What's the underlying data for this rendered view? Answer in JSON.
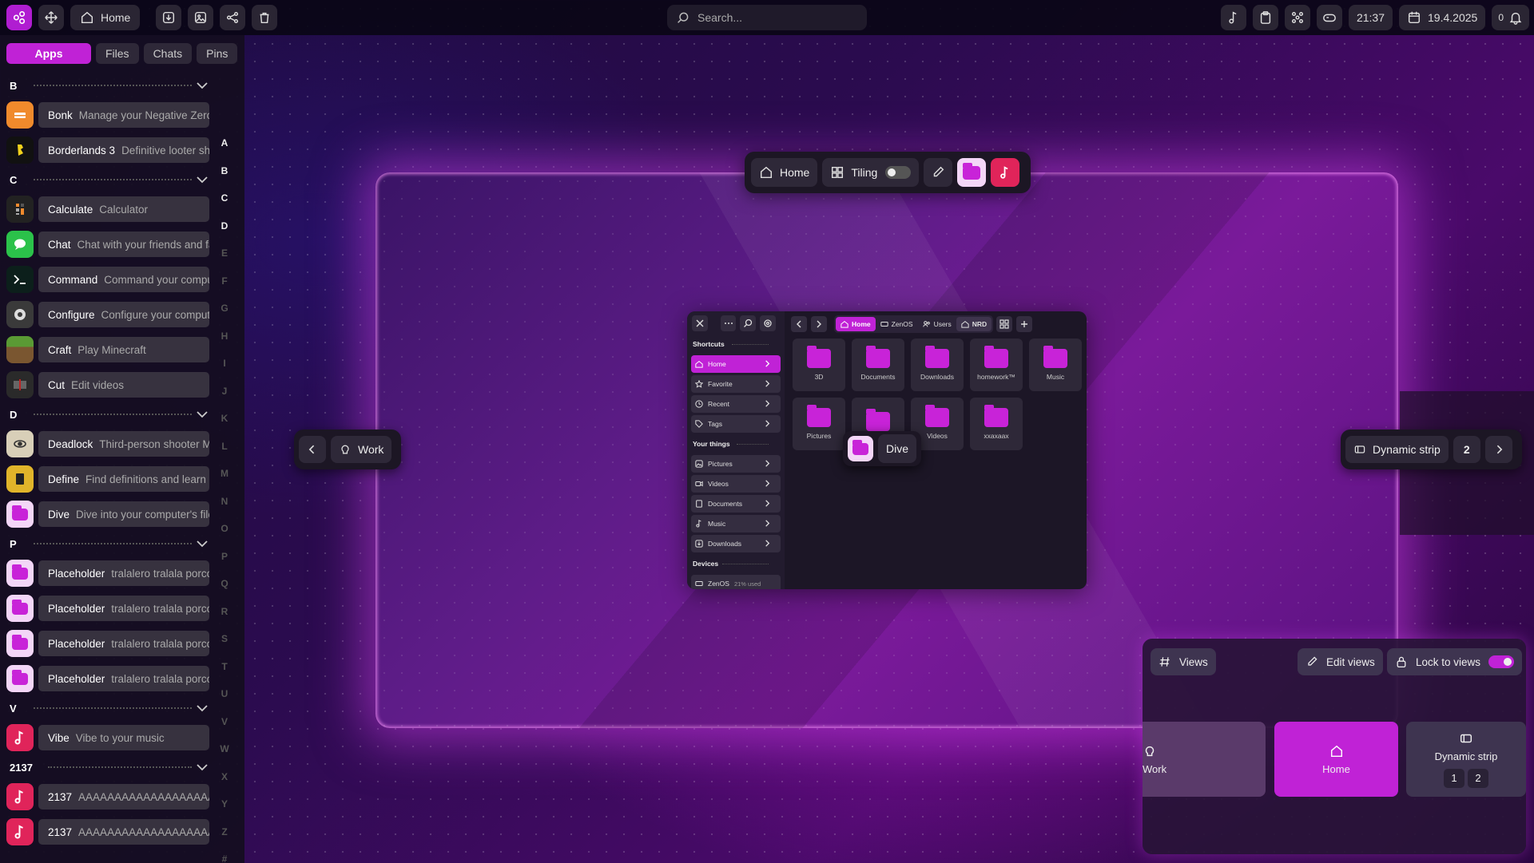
{
  "topbar": {
    "home_label": "Home",
    "search_placeholder": "Search...",
    "time": "21:37",
    "date": "19.4.2025",
    "notif_count": "0",
    "accent": "#b01dd1"
  },
  "left": {
    "tabs": [
      "Apps",
      "Files",
      "Chats",
      "Pins"
    ],
    "sections": {
      "B": "B",
      "C": "C",
      "D": "D",
      "P": "P",
      "V": "V",
      "N": "2137"
    },
    "apps": {
      "bonk": {
        "name": "Bonk",
        "desc": "Manage your Negative Zero"
      },
      "borderlands": {
        "name": "Borderlands 3",
        "desc": "Definitive looter shooter"
      },
      "calculate": {
        "name": "Calculate",
        "desc": "Calculator"
      },
      "chat": {
        "name": "Chat",
        "desc": "Chat with your friends and family"
      },
      "command": {
        "name": "Command",
        "desc": "Command your computer"
      },
      "configure": {
        "name": "Configure",
        "desc": "Configure your computer"
      },
      "craft": {
        "name": "Craft",
        "desc": "Play Minecraft"
      },
      "cut": {
        "name": "Cut",
        "desc": "Edit videos"
      },
      "deadlock": {
        "name": "Deadlock",
        "desc": "Third-person shooter MOBA"
      },
      "define": {
        "name": "Define",
        "desc": "Find definitions and learn"
      },
      "dive": {
        "name": "Dive",
        "desc": "Dive into your computer's files"
      },
      "ph1": {
        "name": "Placeholder",
        "desc": "tralalero tralala porco dio"
      },
      "ph2": {
        "name": "Placeholder",
        "desc": "tralalero tralala porco dio"
      },
      "ph3": {
        "name": "Placeholder",
        "desc": "tralalero tralala porco dio"
      },
      "ph4": {
        "name": "Placeholder",
        "desc": "tralalero tralala porco dio"
      },
      "vibe": {
        "name": "Vibe",
        "desc": "Vibe to your music"
      },
      "n1": {
        "name": "2137",
        "desc": "AAAAAAAAAAAAAAAAAAAA"
      },
      "n2": {
        "name": "2137",
        "desc": "AAAAAAAAAAAAAAAAAAAA"
      }
    },
    "alphabet": [
      "A",
      "B",
      "C",
      "D",
      "E",
      "F",
      "G",
      "H",
      "I",
      "J",
      "K",
      "L",
      "M",
      "N",
      "O",
      "P",
      "Q",
      "R",
      "S",
      "T",
      "U",
      "V",
      "W",
      "X",
      "Y",
      "Z",
      "#"
    ]
  },
  "floatbar": {
    "home": "Home",
    "tiling": "Tiling"
  },
  "pills": {
    "work": "Work",
    "dynamic": "Dynamic strip",
    "dynamic_num": "2",
    "dive": "Dive"
  },
  "fm": {
    "shortcuts": "Shortcuts",
    "short_items": [
      "Home",
      "Favorite",
      "Recent",
      "Tags"
    ],
    "your_things": "Your things",
    "thing_items": [
      "Pictures",
      "Videos",
      "Documents",
      "Music",
      "Downloads"
    ],
    "devices": "Devices",
    "device": "ZenOS",
    "device_usage": "21% used",
    "crumbs": [
      "Home",
      "ZenOS",
      "Users",
      "NRD"
    ],
    "grid": [
      "3D",
      "Documents",
      "Downloads",
      "homework™",
      "Music",
      "Pictures",
      "",
      "Videos",
      "xxaxaax"
    ]
  },
  "views": {
    "views": "Views",
    "edit": "Edit views",
    "lock": "Lock to views",
    "work": "Work",
    "home": "Home",
    "dynamic": "Dynamic strip",
    "n1": "1",
    "n2": "2"
  }
}
